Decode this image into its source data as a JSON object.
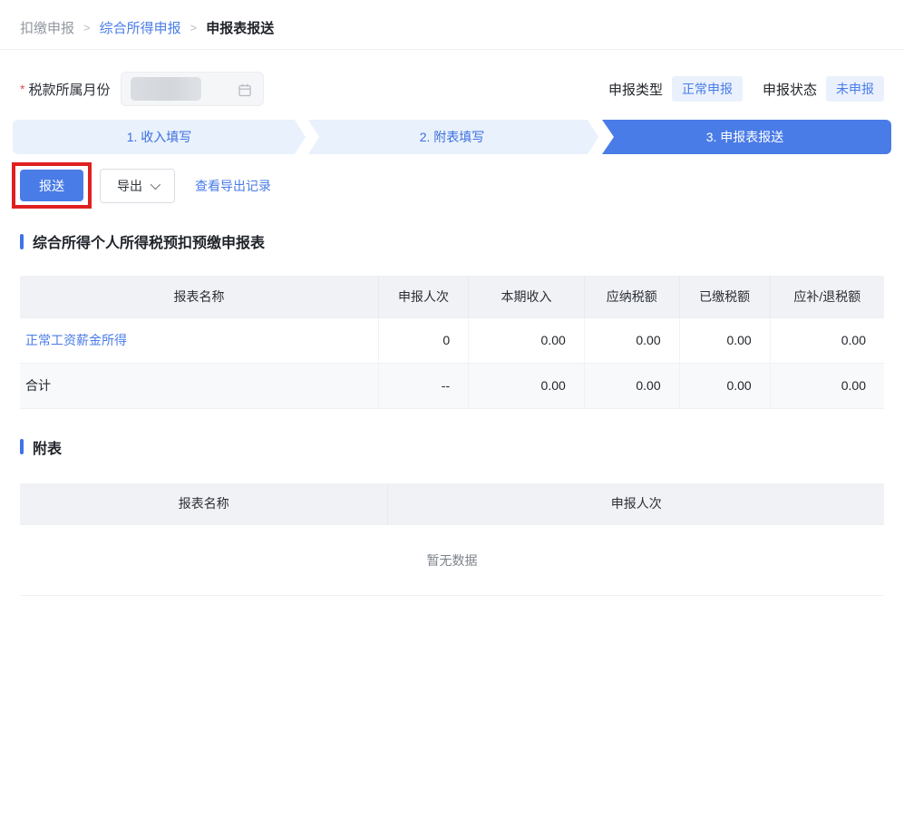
{
  "breadcrumb": {
    "separator": ">",
    "items": [
      {
        "label": "扣缴申报"
      },
      {
        "label": "综合所得申报"
      },
      {
        "label": "申报表报送"
      }
    ]
  },
  "form": {
    "required_mark": "*",
    "month_label": "税款所属月份",
    "month_value_redacted": "",
    "calendar_icon": "calendar-icon"
  },
  "status_bar": {
    "declare_type_label": "申报类型",
    "declare_type_value": "正常申报",
    "declare_status_label": "申报状态",
    "declare_status_value": "未申报"
  },
  "steps": [
    {
      "label": "1. 收入填写",
      "active": false
    },
    {
      "label": "2. 附表填写",
      "active": false
    },
    {
      "label": "3. 申报表报送",
      "active": true
    }
  ],
  "toolbar": {
    "submit_label": "报送",
    "export_label": "导出",
    "view_export_records_label": "查看导出记录"
  },
  "main_table": {
    "section_title": "综合所得个人所得税预扣预缴申报表",
    "headers": [
      "报表名称",
      "申报人次",
      "本期收入",
      "应纳税额",
      "已缴税额",
      "应补/退税额"
    ],
    "rows": [
      {
        "name": "正常工资薪金所得",
        "is_link": true,
        "values": [
          "0",
          "0.00",
          "0.00",
          "0.00",
          "0.00"
        ]
      },
      {
        "name": "合计",
        "is_link": false,
        "values": [
          "--",
          "0.00",
          "0.00",
          "0.00",
          "0.00"
        ]
      }
    ]
  },
  "appendix_table": {
    "section_title": "附表",
    "headers": [
      "报表名称",
      "申报人次"
    ],
    "empty_text": "暂无数据"
  },
  "colors": {
    "accent_blue": "#4a7ce8",
    "step_inactive_bg": "#e9f1fc",
    "badge_bg": "#eaf1fd",
    "annotation_red": "#e02020",
    "table_header_bg": "#f0f2f5"
  }
}
